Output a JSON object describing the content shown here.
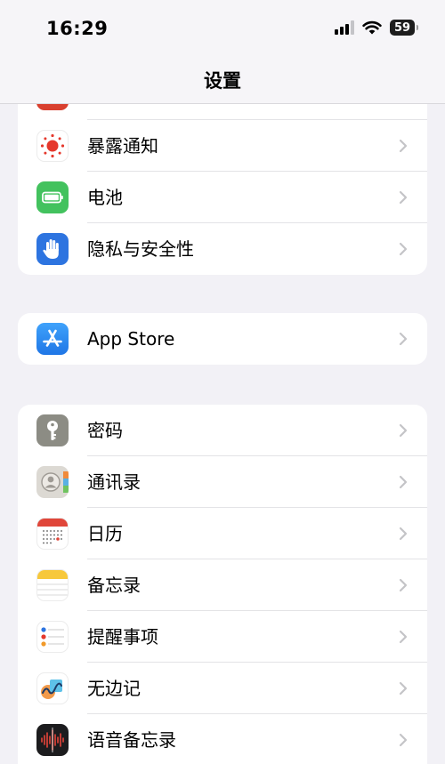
{
  "status_bar": {
    "time": "16:29",
    "battery_level": "59"
  },
  "nav": {
    "title": "设置"
  },
  "groups": [
    {
      "items": [
        {
          "label": "",
          "icon": "partial-red-icon",
          "icon_color": "#d9402f"
        },
        {
          "label": "暴露通知",
          "icon": "exposure-notification-icon",
          "icon_color": "#e5382c"
        },
        {
          "label": "电池",
          "icon": "battery-icon",
          "icon_color": "#43c25e"
        },
        {
          "label": "隐私与安全性",
          "icon": "privacy-hand-icon",
          "icon_color": "#2d74e0"
        }
      ]
    },
    {
      "items": [
        {
          "label": "App Store",
          "icon": "app-store-icon",
          "icon_color": "#2f8ef7"
        }
      ]
    },
    {
      "items": [
        {
          "label": "密码",
          "icon": "key-icon",
          "icon_color": "#8c8c84"
        },
        {
          "label": "通讯录",
          "icon": "contacts-icon",
          "icon_color": "#b9b6b0"
        },
        {
          "label": "日历",
          "icon": "calendar-icon",
          "icon_color": "#e0463a"
        },
        {
          "label": "备忘录",
          "icon": "notes-icon",
          "icon_color": "#f7c83b"
        },
        {
          "label": "提醒事项",
          "icon": "reminders-icon",
          "icon_color": "#ffffff"
        },
        {
          "label": "无边记",
          "icon": "freeform-icon",
          "icon_color": "#ffffff"
        },
        {
          "label": "语音备忘录",
          "icon": "voice-memos-icon",
          "icon_color": "#1c1c1e"
        }
      ]
    }
  ]
}
